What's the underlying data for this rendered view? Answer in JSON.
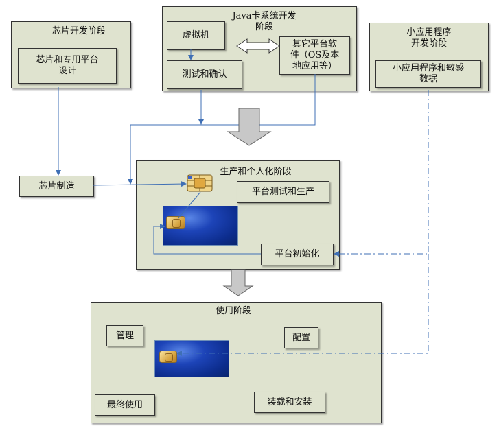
{
  "chip_dev": {
    "title": "芯片开发阶段",
    "box": "芯片和专用平台\n设计"
  },
  "java_dev": {
    "title": "Java卡系统开发\n阶段",
    "vm": "虚拟机",
    "test": "测试和确认",
    "other": "其它平台软\n件（OS及本\n地应用等）"
  },
  "applet_dev": {
    "title": "小应用程序\n开发阶段",
    "box": "小应用程序和敏感\n数据"
  },
  "chip_mfg": "芯片制造",
  "production": {
    "title": "生产和个人化阶段",
    "test_prod": "平台测试和生产",
    "init": "平台初始化"
  },
  "usage": {
    "title": "使用阶段",
    "manage": "管理",
    "config": "配置",
    "end_use": "最终使用",
    "install": "装载和安装"
  },
  "colors": {
    "panel": "#dfe3cf",
    "wire": "#3f6fb5",
    "arrow_fill": "#c8c8c8"
  }
}
